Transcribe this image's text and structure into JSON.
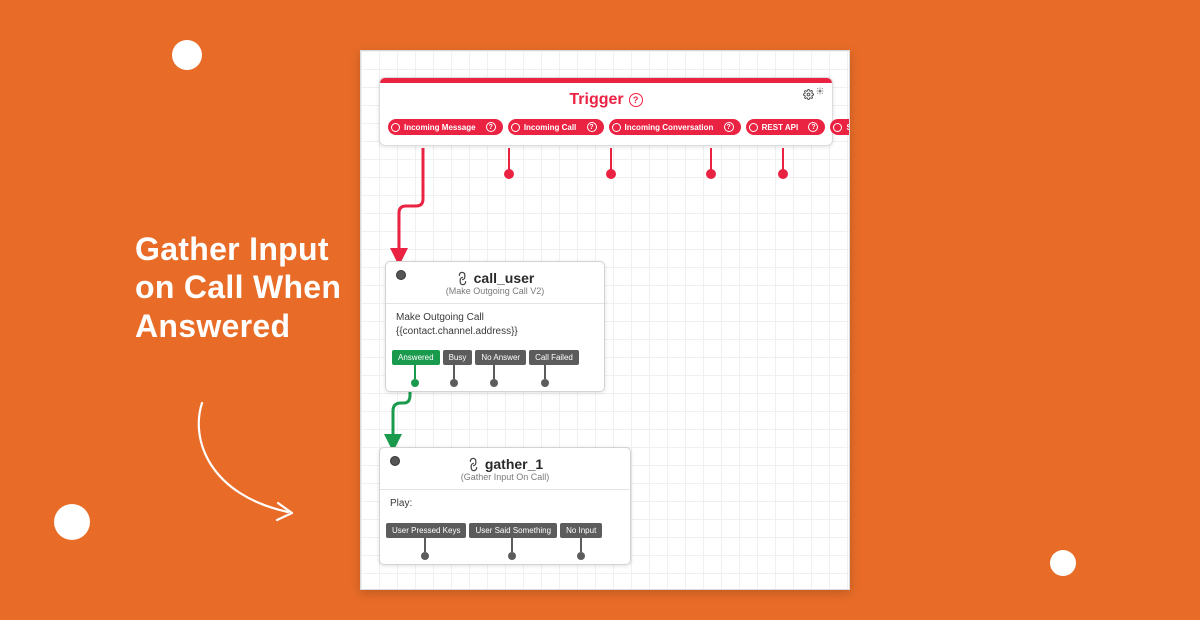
{
  "colors": {
    "accent": "#e86c28",
    "red": "#eb2343",
    "green": "#1a9a4d",
    "gray": "#5c5c5c"
  },
  "heading": "Gather Input on Call When Answered",
  "trigger": {
    "title": "Trigger",
    "events": [
      {
        "label": "Incoming Message"
      },
      {
        "label": "Incoming Call"
      },
      {
        "label": "Incoming Conversation"
      },
      {
        "label": "REST API"
      },
      {
        "label": "Subflow"
      }
    ]
  },
  "call_user": {
    "title": "call_user",
    "subtitle": "(Make Outgoing Call V2)",
    "body_line1": "Make Outgoing Call",
    "body_line2": "{{contact.channel.address}}",
    "outs": [
      "Answered",
      "Busy",
      "No Answer",
      "Call Failed"
    ]
  },
  "gather_1": {
    "title": "gather_1",
    "subtitle": "(Gather Input On Call)",
    "body": "Play:",
    "outs": [
      "User Pressed Keys",
      "User Said Something",
      "No Input"
    ]
  }
}
